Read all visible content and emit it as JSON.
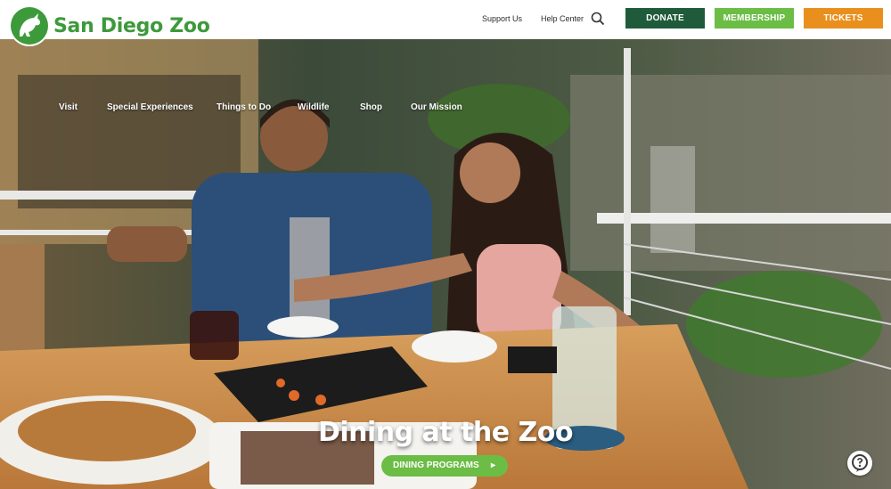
{
  "brand": {
    "name": "San Diego Zoo"
  },
  "utility": {
    "support": "Support Us",
    "help": "Help Center",
    "search_icon": "search-icon"
  },
  "cta": {
    "donate": "DONATE",
    "membership": "MEMBERSHIP",
    "tickets": "TICKETS"
  },
  "colors": {
    "brand_green": "#3d9a3a",
    "donate": "#1f5b3a",
    "membership": "#6bbd45",
    "tickets": "#e98f1d"
  },
  "nav": [
    "Visit",
    "Special Experiences",
    "Things to Do",
    "Wildlife",
    "Shop",
    "Our Mission"
  ],
  "hero": {
    "title": "Dining at the Zoo",
    "button": "DINING PROGRAMS"
  }
}
